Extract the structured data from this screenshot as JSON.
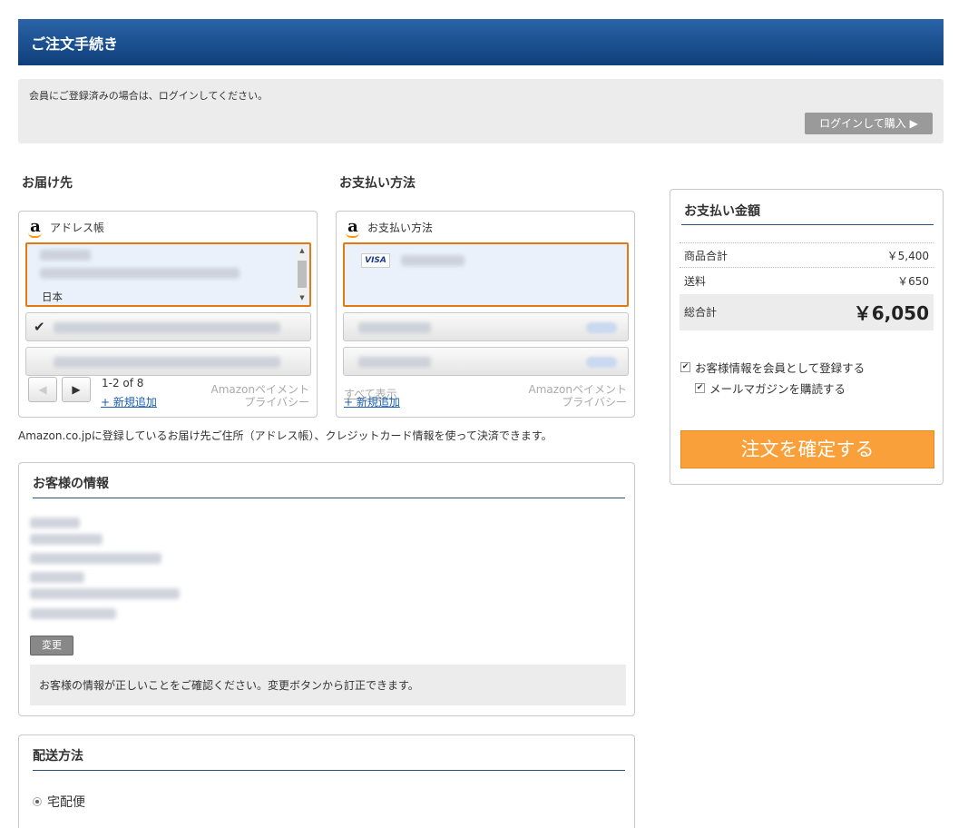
{
  "header": {
    "title": "ご注文手続き"
  },
  "login": {
    "message": "会員にご登録済みの場合は、ログインしてください。",
    "button": "ログインして購入 ▶"
  },
  "delivery": {
    "title": "お届け先",
    "widget_title": "アドレス帳",
    "selected_country": "日本",
    "pager_text": "1-2 of 8",
    "add_new": "+ 新規追加",
    "footer": "Amazonペイメントプライバシー"
  },
  "payment": {
    "title": "お支払い方法",
    "widget_title": "お支払い方法",
    "card_brand": "VISA",
    "show_all": "すべて表示",
    "add_new": "+ 新規追加",
    "footer": "Amazonペイメントプライバシー"
  },
  "note": "Amazon.co.jpに登録しているお届け先ご住所（アドレス帳）、クレジットカード情報を使って決済できます。",
  "customer": {
    "title": "お客様の情報",
    "change_button": "変更",
    "confirm_message": "お客様の情報が正しいことをご確認ください。変更ボタンから訂正できます。"
  },
  "shipping": {
    "title": "配送方法",
    "option": "宅配便"
  },
  "summary": {
    "title": "お支払い金額",
    "subtotal_label": "商品合計",
    "subtotal_value": "￥5,400",
    "shipping_label": "送料",
    "shipping_value": "￥650",
    "total_label": "総合計",
    "total_value": "￥6,050",
    "register_label": "お客様情報を会員として登録する",
    "newsletter_label": "メールマガジンを購読する",
    "order_button": "注文を確定する"
  },
  "colors": {
    "header": "#1a4d8c",
    "accent": "#e47911",
    "order_button": "#f9a03a",
    "link": "#1a5fb4"
  }
}
